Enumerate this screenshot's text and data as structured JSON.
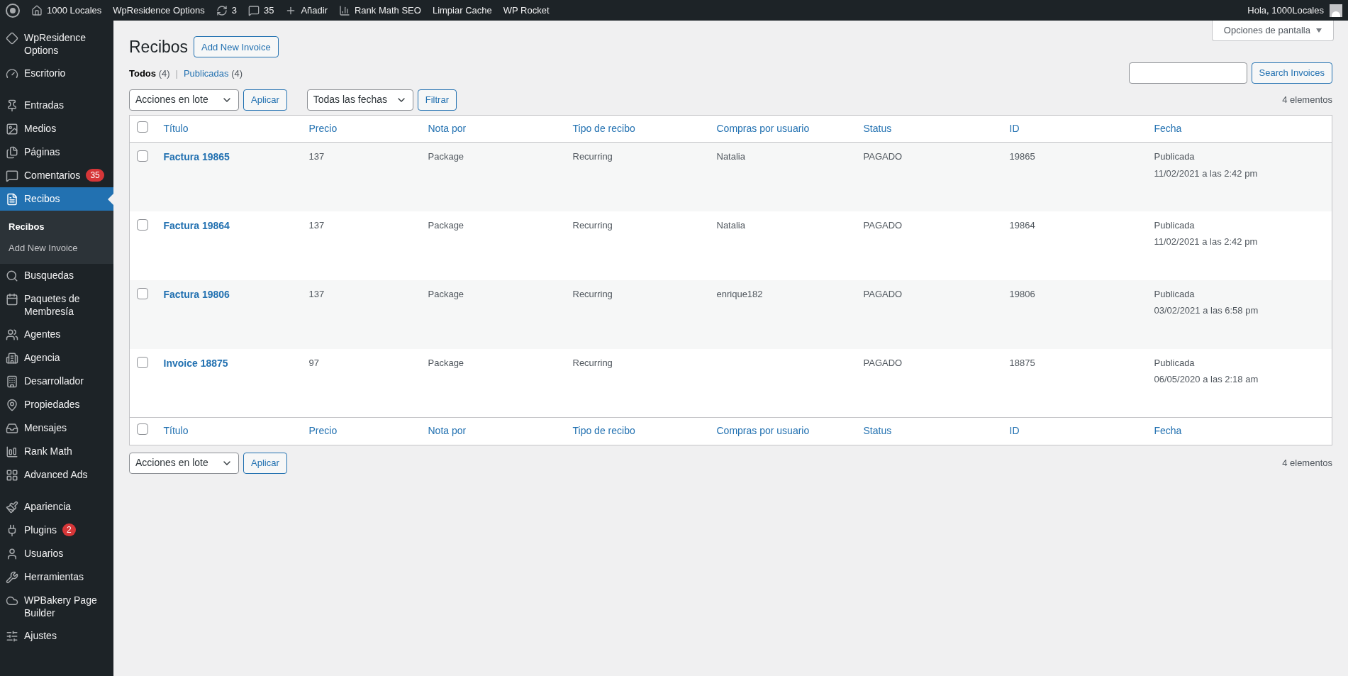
{
  "admin_bar": {
    "site": "1000 Locales",
    "items": [
      {
        "kind": "text",
        "label": "WpResidence Options"
      },
      {
        "kind": "updates",
        "label": "3"
      },
      {
        "kind": "comments",
        "label": "35"
      },
      {
        "kind": "new",
        "label": "Añadir"
      },
      {
        "kind": "rankmath",
        "label": "Rank Math SEO"
      },
      {
        "kind": "text",
        "label": "Limpiar Cache"
      },
      {
        "kind": "text",
        "label": "WP Rocket"
      }
    ],
    "greeting": "Hola, 1000Locales"
  },
  "sidebar": {
    "groups": [
      [
        {
          "label": "WpResidence Options",
          "selected": false
        },
        {
          "label": "Escritorio",
          "selected": false
        }
      ],
      [
        {
          "label": "Entradas",
          "selected": false
        },
        {
          "label": "Medios",
          "selected": false
        },
        {
          "label": "Páginas",
          "selected": false
        },
        {
          "label": "Comentarios",
          "selected": false,
          "badge": "35"
        },
        {
          "label": "Recibos",
          "selected": true,
          "children": [
            {
              "label": "Recibos",
              "selected": true
            },
            {
              "label": "Add New Invoice",
              "selected": false
            }
          ]
        },
        {
          "label": "Busquedas",
          "selected": false
        },
        {
          "label": "Paquetes de Membresía",
          "selected": false
        },
        {
          "label": "Agentes",
          "selected": false
        },
        {
          "label": "Agencia",
          "selected": false
        },
        {
          "label": "Desarrollador",
          "selected": false
        },
        {
          "label": "Propiedades",
          "selected": false
        },
        {
          "label": "Mensajes",
          "selected": false
        },
        {
          "label": "Rank Math",
          "selected": false
        },
        {
          "label": "Advanced Ads",
          "selected": false
        }
      ],
      [
        {
          "label": "Apariencia",
          "selected": false
        },
        {
          "label": "Plugins",
          "selected": false,
          "badge": "2"
        },
        {
          "label": "Usuarios",
          "selected": false
        },
        {
          "label": "Herramientas",
          "selected": false
        },
        {
          "label": "WPBakery Page Builder",
          "selected": false
        },
        {
          "label": "Ajustes",
          "selected": false
        }
      ]
    ]
  },
  "screen_options": "Opciones de pantalla",
  "title": "Recibos",
  "add_new": "Add New Invoice",
  "views_separator": "|",
  "views": [
    {
      "label": "Todos",
      "count": "(4)",
      "selected": true
    },
    {
      "label": "Publicadas",
      "count": "(4)",
      "selected": false
    }
  ],
  "search_button": "Search Invoices",
  "bulk_action": "Acciones en lote",
  "apply": "Aplicar",
  "date_filter": "Todas las fechas",
  "filter": "Filtrar",
  "item_count": "4 elementos",
  "table": {
    "select_all_top": {
      "checked": false
    },
    "select_all_bottom": {
      "checked": false
    },
    "columns": [
      "Título",
      "Precio",
      "Nota por",
      "Tipo de recibo",
      "Compras por usuario",
      "Status",
      "ID",
      "Fecha"
    ],
    "footer_columns": [
      "Título",
      "Precio",
      "Nota por",
      "Tipo de recibo",
      "Compras por usuario",
      "Status",
      "ID",
      "Fecha"
    ],
    "rows": [
      {
        "checked": false,
        "title": "Factura 19865",
        "price": "137",
        "note": "Package",
        "type": "Recurring",
        "user": "Natalia",
        "status": "PAGADO",
        "id": "19865",
        "state": "Publicada",
        "date": "11/02/2021 a las 2:42 pm"
      },
      {
        "checked": false,
        "title": "Factura 19864",
        "price": "137",
        "note": "Package",
        "type": "Recurring",
        "user": "Natalia",
        "status": "PAGADO",
        "id": "19864",
        "state": "Publicada",
        "date": "11/02/2021 a las 2:42 pm"
      },
      {
        "checked": false,
        "title": "Factura 19806",
        "price": "137",
        "note": "Package",
        "type": "Recurring",
        "user": "enrique182",
        "status": "PAGADO",
        "id": "19806",
        "state": "Publicada",
        "date": "03/02/2021 a las 6:58 pm"
      },
      {
        "checked": false,
        "title": "Invoice 18875",
        "price": "97",
        "note": "Package",
        "type": "Recurring",
        "status": "PAGADO",
        "id": "18875",
        "state": "Publicada",
        "date": "06/05/2020 a las 2:18 am"
      }
    ]
  },
  "bottom": {
    "bulk_action": "Acciones en lote",
    "apply": "Aplicar",
    "item_count": "4 elementos"
  }
}
